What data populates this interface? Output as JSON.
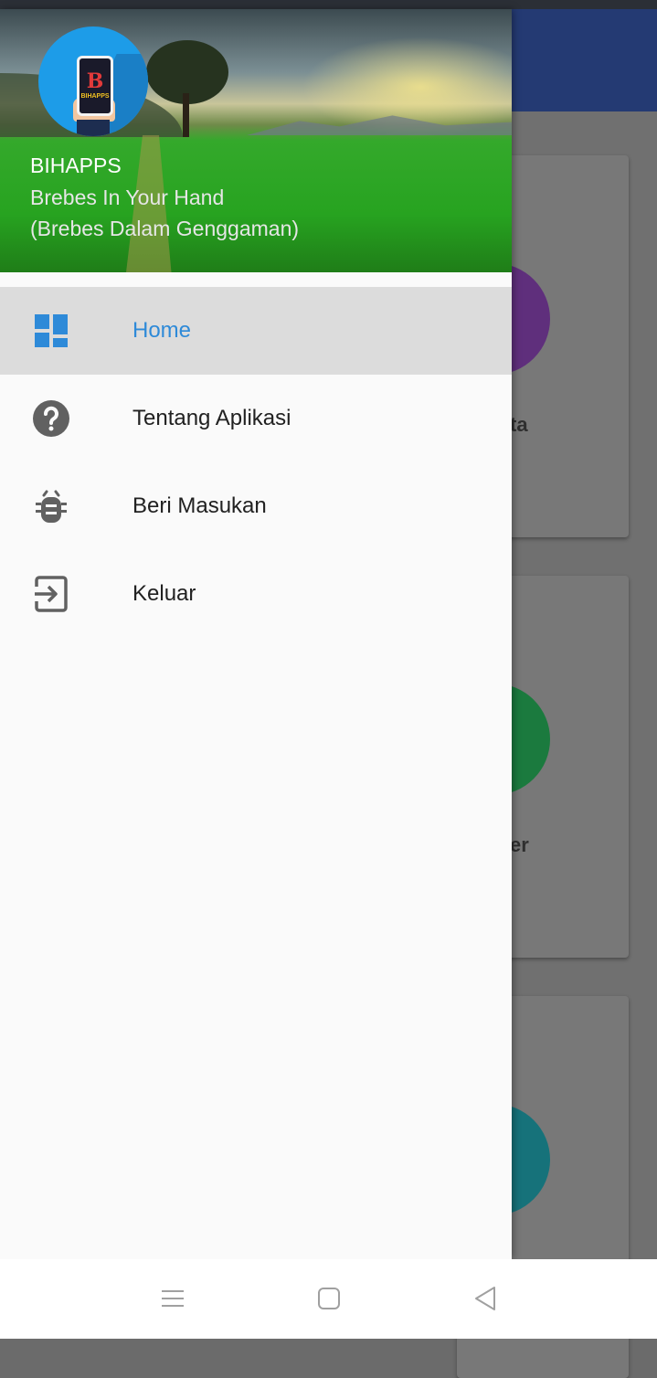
{
  "header": {
    "app_name": "BIHAPPS",
    "tagline_line1": "Brebes In Your Hand",
    "tagline_line2": "(Brebes Dalam Genggaman)",
    "logo_letter": "B",
    "logo_text": "BIHAPPS"
  },
  "menu": {
    "items": [
      {
        "label": "Home",
        "icon": "dashboard-icon",
        "active": true
      },
      {
        "label": "Tentang Aplikasi",
        "icon": "help-circle-icon",
        "active": false
      },
      {
        "label": "Beri Masukan",
        "icon": "bug-icon",
        "active": false
      },
      {
        "label": "Keluar",
        "icon": "exit-icon",
        "active": false
      }
    ]
  },
  "background_cards": [
    {
      "label_fragment": "ta",
      "circle_color": "#5f2f7c"
    },
    {
      "label_fragment": "er",
      "circle_color": "#1b7a3e"
    },
    {
      "label_fragment": "",
      "circle_color": "#16727a"
    }
  ],
  "nav_bar": {
    "buttons": [
      "menu-icon",
      "home-square-icon",
      "back-triangle-icon"
    ]
  },
  "colors": {
    "accent": "#2e8ad8",
    "app_bar": "#243a73",
    "active_row": "#dcdcdc",
    "icon_gray": "#616161"
  }
}
